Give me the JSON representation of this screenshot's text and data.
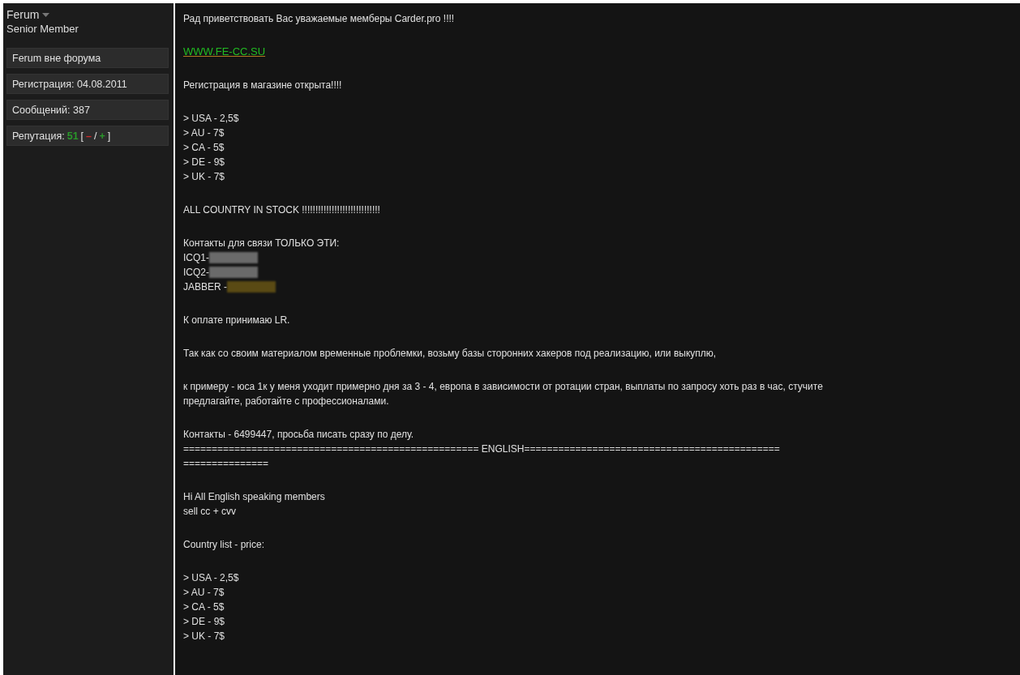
{
  "author": {
    "name": "Ferum",
    "title": "Senior Member"
  },
  "author_info": [
    {
      "text": "Ferum вне форума"
    },
    {
      "text": "Регистрация: 04.08.2011"
    },
    {
      "text": "Сообщений: 387"
    }
  ],
  "reputation": [
    {
      "text": "Репутация:"
    },
    {
      "text": "51",
      "color": "#2a9a2a"
    },
    {
      "text": "["
    },
    {
      "text": "–",
      "color": "#cc2a2a"
    },
    {
      "text": "/"
    },
    {
      "text": "+",
      "color": "#2a9a2a"
    },
    {
      "text": "]"
    }
  ],
  "post": [
    {
      "lines": [
        {
          "kind": "text",
          "text": "Рад приветствовать Вас уважаемые мемберы Carder.pro !!!!"
        }
      ]
    },
    {
      "lines": [
        {
          "kind": "link",
          "text": "WWW.FE-CC.SU"
        }
      ]
    },
    {
      "lines": [
        {
          "kind": "text",
          "text": "Регистрация в магазине открыта!!!!"
        }
      ]
    },
    {
      "lines": [
        {
          "kind": "text",
          "text": "> USA - 2,5$"
        },
        {
          "kind": "text",
          "text": "> AU - 7$"
        },
        {
          "kind": "text",
          "text": "> CA - 5$"
        },
        {
          "kind": "text",
          "text": "> DE - 9$"
        },
        {
          "kind": "text",
          "text": "> UK - 7$"
        }
      ]
    },
    {
      "lines": [
        {
          "kind": "text",
          "text": "ALL COUNTRY IN STOCK !!!!!!!!!!!!!!!!!!!!!!!!!!!!!"
        }
      ]
    },
    {
      "lines": [
        {
          "kind": "text",
          "text": "Контакты для связи ТОЛЬКО ЭТИ:"
        },
        {
          "kind": "redacted",
          "text": "ICQ1-",
          "color": "#6a6a6a"
        },
        {
          "kind": "redacted",
          "text": "ICQ2-",
          "color": "#6a6a6a"
        },
        {
          "kind": "redacted",
          "text": "JABBER -",
          "color": "#5a4a14"
        }
      ]
    },
    {
      "lines": [
        {
          "kind": "text",
          "text": "К оплате принимаю LR."
        }
      ]
    },
    {
      "lines": [
        {
          "kind": "text",
          "text": "Так как со своим материалом временные проблемки, возьму базы сторонних хакеров под реализацию, или выкуплю,"
        }
      ]
    },
    {
      "lines": [
        {
          "kind": "text",
          "text": "к примеру - юса 1к у меня уходит примерно дня за 3 - 4, европа в зависимости от ротации стран, выплаты по запросу хоть раз в час, стучите"
        },
        {
          "kind": "text",
          "text": "предлагайте, работайте с профессионалами."
        }
      ]
    },
    {
      "lines": [
        {
          "kind": "text",
          "text": "Контакты - 6499447, просьба писать сразу по делу."
        },
        {
          "kind": "text",
          "text": "==================================================== ENGLISH============================================="
        },
        {
          "kind": "text",
          "text": "==============="
        }
      ]
    },
    {
      "lines": [
        {
          "kind": "text",
          "text": "Hi All English speaking members"
        },
        {
          "kind": "text",
          "text": "sell cc + cvv"
        }
      ]
    },
    {
      "lines": [
        {
          "kind": "text",
          "text": "Country list - price:"
        }
      ]
    },
    {
      "lines": [
        {
          "kind": "text",
          "text": "> USA - 2,5$"
        },
        {
          "kind": "text",
          "text": "> AU - 7$"
        },
        {
          "kind": "text",
          "text": "> CA - 5$"
        },
        {
          "kind": "text",
          "text": "> DE - 9$"
        },
        {
          "kind": "text",
          "text": "> UK - 7$"
        }
      ]
    }
  ]
}
